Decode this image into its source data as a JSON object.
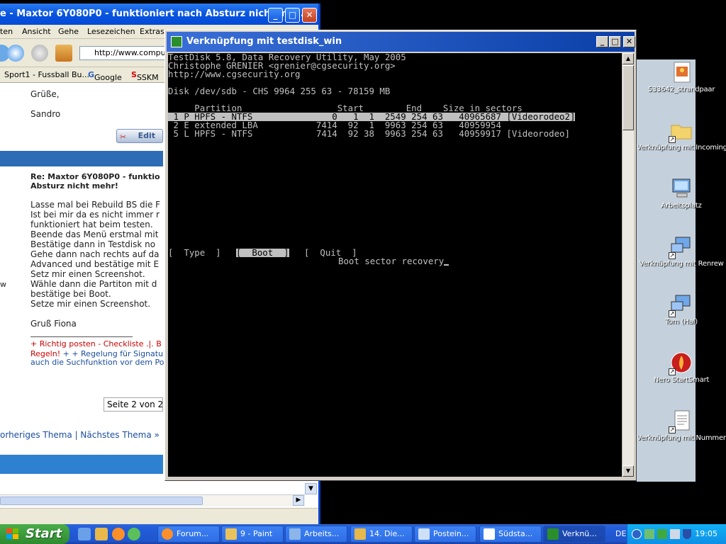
{
  "desktop": {
    "icons": [
      {
        "label": "533642_strandpaar",
        "icon": "image-file-icon"
      },
      {
        "label": "Verknüpfung mit Incoming",
        "icon": "folder-shortcut-icon"
      },
      {
        "label": "Arbeitsplatz",
        "icon": "my-computer-icon"
      },
      {
        "label": "Verknüpfung mit Renrew",
        "icon": "network-shortcut-icon"
      },
      {
        "label": "Tom (Hal)",
        "icon": "network-computer-icon"
      },
      {
        "label": "Nero StartSmart",
        "icon": "nero-icon"
      },
      {
        "label": "Verknüpfung mit Nummer",
        "icon": "text-file-shortcut-icon"
      }
    ]
  },
  "browser": {
    "title": "e - Maxtor 6Y080P0 - funktioniert nach Absturz nicht meh...",
    "menu": [
      "ten",
      "Ansicht",
      "Gehe",
      "Lesezeichen",
      "Extras"
    ],
    "url": "http://www.comput",
    "bookmarks": [
      "Sport1 - Fussball Bu...",
      "Google",
      "SSKM"
    ],
    "greeting": "Grüße,",
    "signature": "Sandro",
    "edit_label": "Edit",
    "post_title_1": "Re: Maxtor 6Y080P0 - funktio",
    "post_title_2": "Absturz nicht mehr!",
    "post_lines": [
      "Lasse mal bei Rebuild BS die F",
      "Ist bei mir da es nicht immer r",
      "funktioniert hat beim testen.",
      "Beende das Menü erstmal mit",
      "Bestätige dann in Testdisk no",
      "Gehe dann nach rechts auf da",
      "Advanced und bestätige mit E",
      "Setz mir einen Screenshot.",
      "Wähle dann die Partiton mit d",
      "bestätige bei Boot.",
      "Setze mir einen Screenshot."
    ],
    "sign_off": "Gruß Fiona",
    "footer_link_1": "+ Richtig posten - Checkliste .|. B",
    "footer_link_2a": "Regeln!",
    "footer_link_2b": "+ + Regelung für Signatu",
    "footer_link_3": "auch die Suchfunktion vor dem Po",
    "left_edge": "w",
    "page_indicator": "Seite 2 von 2",
    "prev_next": "orheriges Thema | Nächstes Thema »"
  },
  "testdisk": {
    "title": "Verknüpfung mit testdisk_win",
    "header_1": "TestDisk 5.8, Data Recovery Utility, May 2005",
    "header_2": "Christophe GRENIER <grenier@cgsecurity.org>",
    "header_3": "http://www.cgsecurity.org",
    "disk_line": "Disk /dev/sdb - CHS 9964 255 63 - 78159 MB",
    "columns": "     Partition                  Start        End    Size in sectors",
    "rows": [
      " 1 P HPFS - NTFS               0   1  1  2549 254 63   40965687 [Videorodeo2]",
      " 2 E extended LBA           7414  92  1  9963 254 63   40959954",
      " 5 L HPFS - NTFS            7414  92 38  9963 254 63   40959917 [Videorodeo]"
    ],
    "menu_type": "[  Type  ]",
    "menu_boot": "[  Boot  ]",
    "menu_quit": "[  Quit  ]",
    "status": "Boot sector recovery"
  },
  "taskbar": {
    "start_label": "Start",
    "buttons": [
      "Forum...",
      "9 - Paint",
      "Arbeits...",
      "14. Die...",
      "Postein...",
      "Südsta...",
      "Verknü..."
    ],
    "lang": "DE",
    "clock": "19:05"
  }
}
